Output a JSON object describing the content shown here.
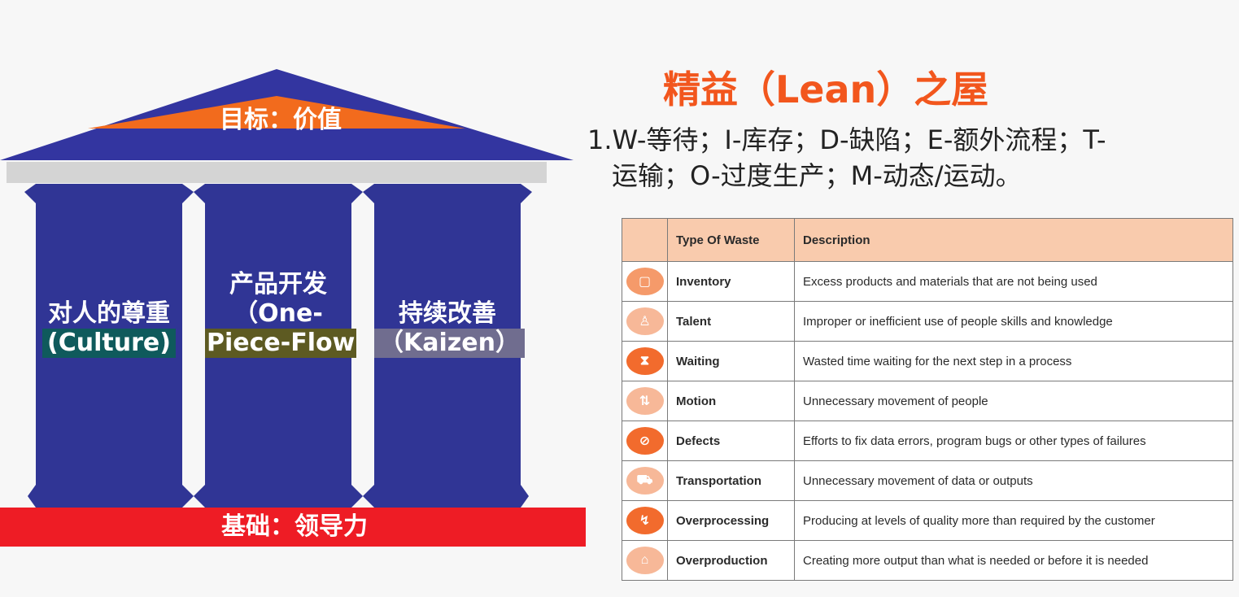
{
  "house": {
    "roof_label": "目标：价值",
    "pillars": [
      {
        "line1": "对人的尊重",
        "line2": "(Culture)"
      },
      {
        "line1": "产品开发",
        "line2": "（One-",
        "line3": "Piece-Flow"
      },
      {
        "line1": "持续改善",
        "line2": "（Kaizen）"
      }
    ],
    "base_label": "基础：领导力",
    "colors": {
      "roof": "#3335a0",
      "roof_band": "#f26b1d",
      "beam": "#d4d4d4",
      "pillar": "#303595",
      "base": "#ee1c25",
      "culture_hl": "#0f5a5c",
      "flow_hl": "#5d5a22",
      "kaizen_hl": "#706d8f"
    }
  },
  "title": "精益（Lean）之屋",
  "description": {
    "line1": "1.W-等待；I-库存；D-缺陷；E-额外流程；T-",
    "line2": "运输；O-过度生产；M-动态/运动。"
  },
  "table": {
    "headers": [
      "",
      "Type Of Waste",
      "Description"
    ],
    "rows": [
      {
        "icon": "box-icon",
        "color": "#f59a6a",
        "glyph": "▢",
        "type": "Inventory",
        "description": "Excess products and materials that are not being used"
      },
      {
        "icon": "person-icon",
        "color": "#f7b898",
        "glyph": "♙",
        "type": "Talent",
        "description": "Improper or inefficient use of people skills and knowledge"
      },
      {
        "icon": "hourglass-icon",
        "color": "#f26b2d",
        "glyph": "⧗",
        "type": "Waiting",
        "description": "Wasted time waiting for the next step in a process"
      },
      {
        "icon": "arrows-icon",
        "color": "#f7b898",
        "glyph": "⇅",
        "type": "Motion",
        "description": "Unnecessary movement of people"
      },
      {
        "icon": "no-sign-icon",
        "color": "#f26b2d",
        "glyph": "⊘",
        "type": "Defects",
        "description": "Efforts to fix data errors, program bugs or other types of failures"
      },
      {
        "icon": "truck-icon",
        "color": "#f7b898",
        "glyph": "⛟",
        "type": "Transportation",
        "description": "Unnecessary movement of data or outputs"
      },
      {
        "icon": "lightning-icon",
        "color": "#f26b2d",
        "glyph": "↯",
        "type": "Overprocessing",
        "description": "Producing at levels of quality more than required by the customer"
      },
      {
        "icon": "factory-icon",
        "color": "#f7b898",
        "glyph": "⌂",
        "type": "Overproduction",
        "description": "Creating more output than what is needed or before it is needed"
      }
    ]
  }
}
